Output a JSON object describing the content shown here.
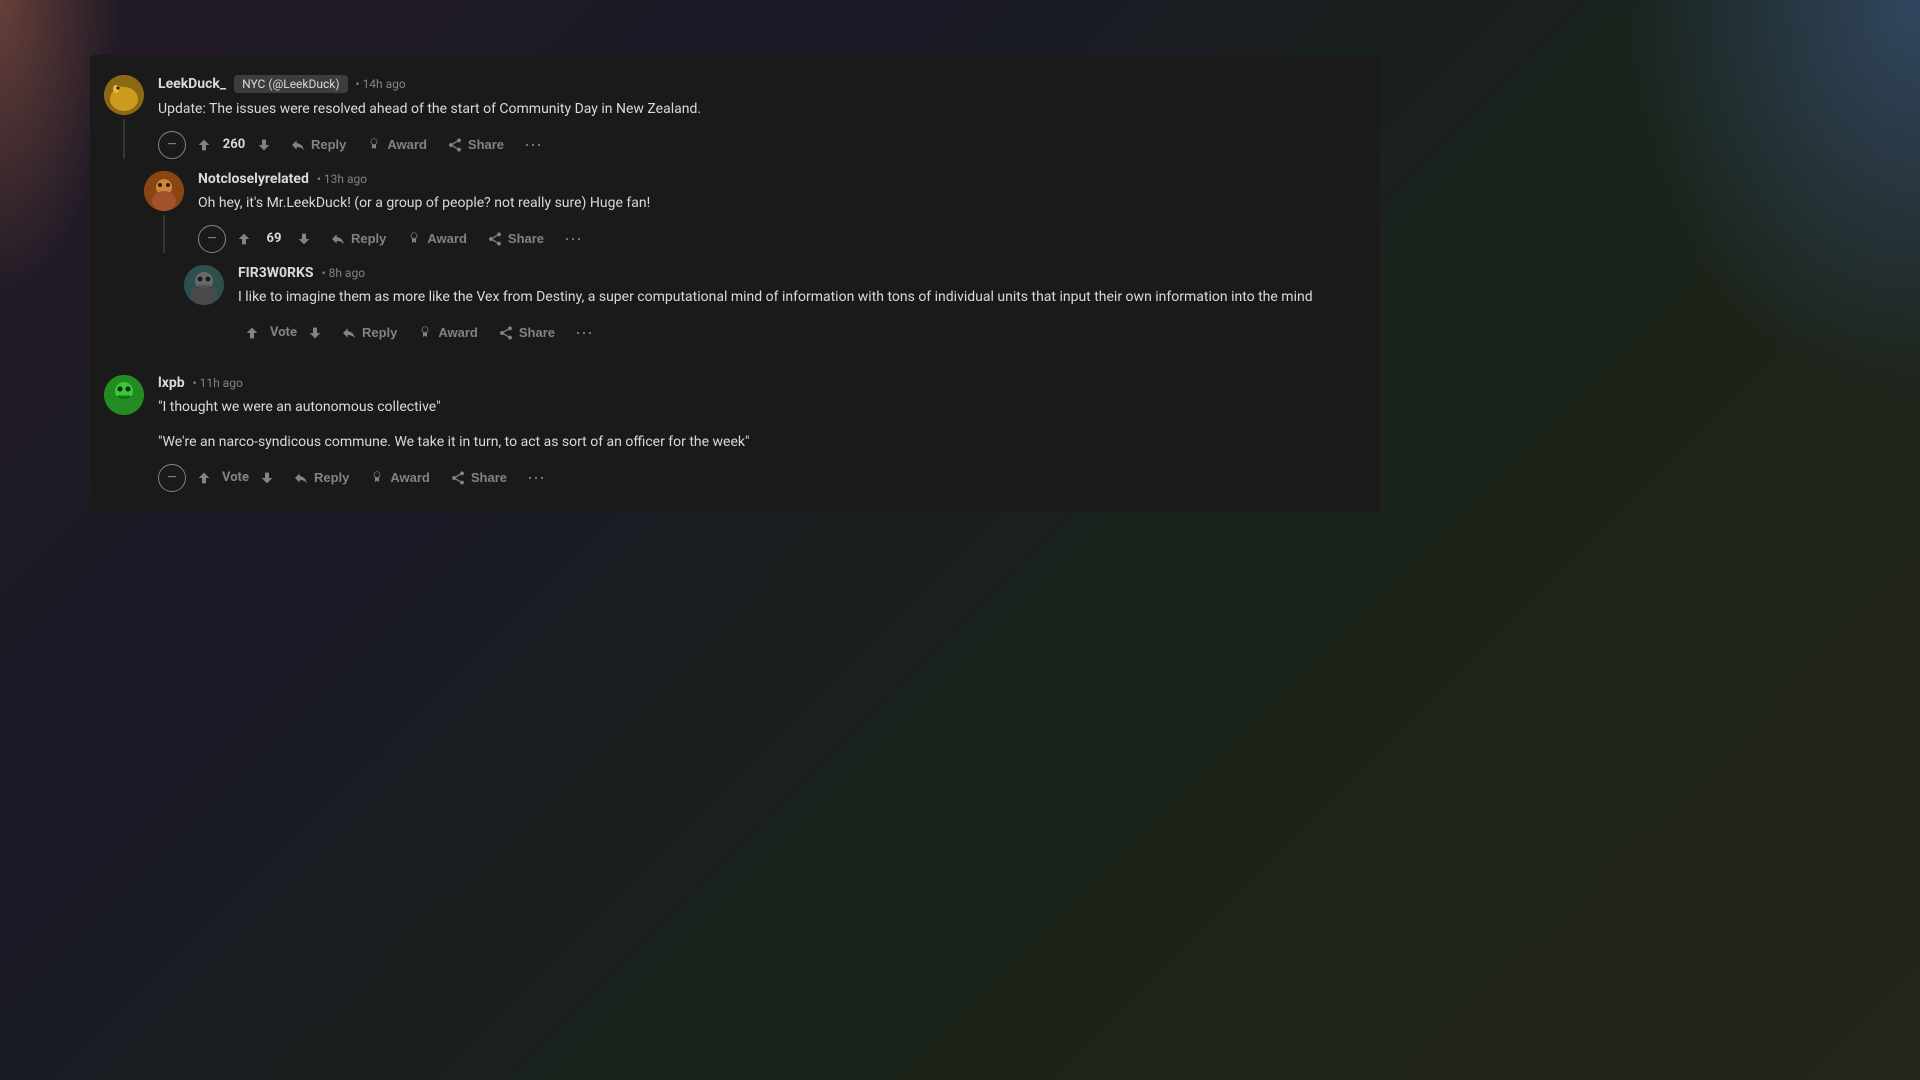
{
  "background": {
    "color": "#1a1a1b"
  },
  "comments": [
    {
      "id": "comment-leekduck",
      "username": "LeekDuck_",
      "user_tag": "NYC (@LeekDuck)",
      "timestamp": "14h ago",
      "text": "Update: The issues were resolved ahead of the start of Community Day in New Zealand.",
      "vote_count": "260",
      "avatar_type": "leekduck",
      "actions": {
        "reply": "Reply",
        "award": "Award",
        "share": "Share"
      },
      "replies": [
        {
          "id": "comment-notclosely",
          "username": "Notcloselyrelated",
          "timestamp": "13h ago",
          "text": "Oh hey, it's Mr.LeekDuck! (or a group of people? not really sure) Huge fan!",
          "vote_count": "69",
          "avatar_type": "notclosely",
          "actions": {
            "reply": "Reply",
            "award": "Award",
            "share": "Share"
          },
          "replies": [
            {
              "id": "comment-fir3w0rks",
              "username": "FIR3W0RKS",
              "timestamp": "8h ago",
              "text": "I like to imagine them as more like the Vex from Destiny, a super computational mind of information with tons of individual units that input their own information into the mind",
              "vote_count": "Vote",
              "vote_is_text": true,
              "avatar_type": "fir3w0rks",
              "actions": {
                "reply": "Reply",
                "award": "Award",
                "share": "Share"
              }
            }
          ]
        }
      ]
    },
    {
      "id": "comment-lxpb",
      "username": "lxpb",
      "timestamp": "11h ago",
      "text_parts": [
        "\"I thought we were an autonomous collective\"",
        "\"We're an narco-syndicous commune. We take it in turn, to act as sort of an officer for the week\""
      ],
      "vote_count": "Vote",
      "vote_is_text": true,
      "avatar_type": "lxpb",
      "actions": {
        "reply": "Reply",
        "award": "Award",
        "share": "Share"
      }
    }
  ],
  "icons": {
    "collapse": "−",
    "up_arrow": "↑",
    "down_arrow": "↓",
    "reply": "💬",
    "award": "🏆",
    "share": "↗",
    "dots": "···"
  }
}
